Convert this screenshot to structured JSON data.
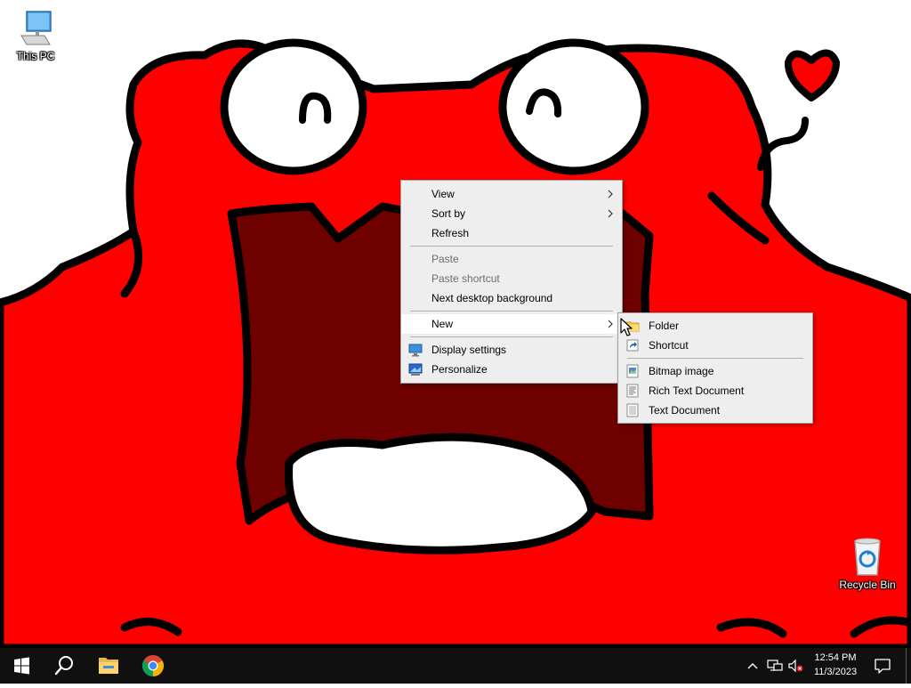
{
  "colors": {
    "wallpaper_red": "#ff0000",
    "mouth_dark": "#6e0000",
    "outline": "#000000",
    "taskbar": "#101010",
    "menu_bg": "#eeeeee"
  },
  "desktop": {
    "icons": [
      {
        "label": "This PC",
        "icon": "computer-icon"
      },
      {
        "label": "Recycle Bin",
        "icon": "recycle-bin-icon"
      }
    ]
  },
  "context_menu": {
    "items": [
      {
        "label": "View",
        "submenu": true
      },
      {
        "label": "Sort by",
        "submenu": true
      },
      {
        "label": "Refresh"
      },
      {
        "label": "Paste",
        "disabled": true
      },
      {
        "label": "Paste shortcut",
        "disabled": true
      },
      {
        "label": "Next desktop background"
      },
      {
        "label": "New",
        "submenu": true,
        "highlighted": true
      },
      {
        "label": "Display settings",
        "icon": "display-settings-icon"
      },
      {
        "label": "Personalize",
        "icon": "personalize-icon"
      }
    ]
  },
  "new_submenu": {
    "items": [
      {
        "label": "Folder",
        "icon": "folder-icon"
      },
      {
        "label": "Shortcut",
        "icon": "shortcut-icon"
      },
      {
        "label": "Bitmap image",
        "icon": "bitmap-image-icon"
      },
      {
        "label": "Rich Text Document",
        "icon": "rich-text-document-icon"
      },
      {
        "label": "Text Document",
        "icon": "text-document-icon"
      }
    ]
  },
  "taskbar": {
    "pinned": [
      "start-icon",
      "search-icon",
      "file-explorer-icon",
      "chrome-icon"
    ],
    "clock": {
      "time": "12:54 PM",
      "date": "11/3/2023"
    },
    "tray": [
      "chevron-up-icon",
      "network-icon",
      "volume-muted-icon",
      "notification-icon"
    ]
  }
}
